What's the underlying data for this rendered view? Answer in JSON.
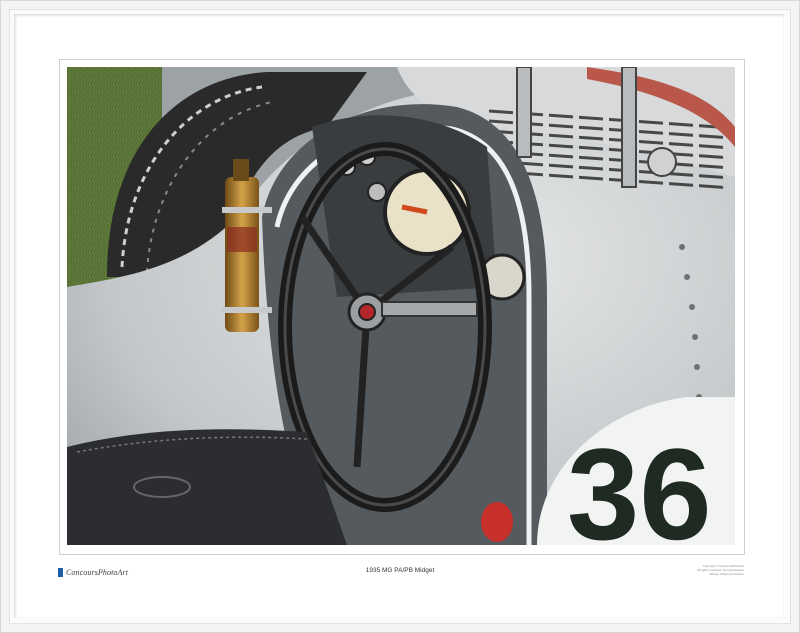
{
  "brand": {
    "name": "ConcoursPhotoArt",
    "accent": "#1d5fa8"
  },
  "caption": {
    "title": "1935 MG PA/PB Midget"
  },
  "fineprint": {
    "line1": "Copyright © ConcoursPhotoArt",
    "line2": "All rights reserved. No reproduction",
    "line3": "without written permission"
  },
  "artwork": {
    "race_number": "36"
  },
  "colors": {
    "body_silver": "#c9ccce",
    "grass": "#5f7a3a",
    "tire": "#2a2a2a",
    "stripe": "#b8574a",
    "brass": "#b8862e"
  }
}
